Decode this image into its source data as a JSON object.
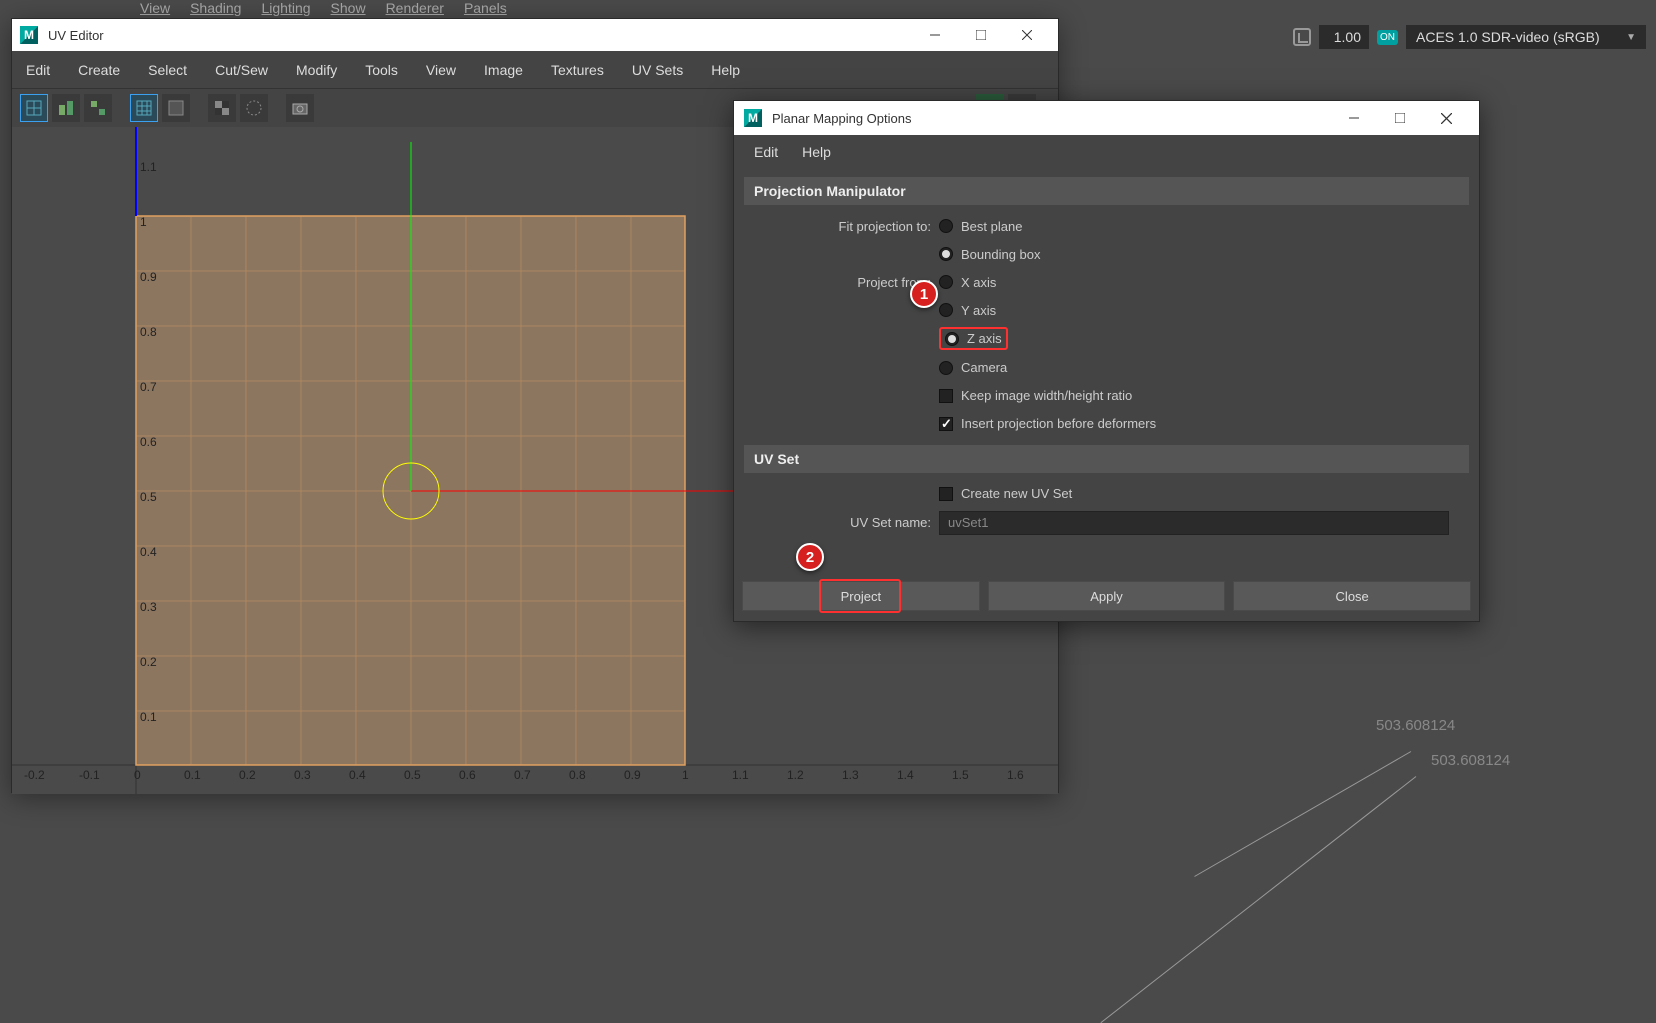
{
  "bg": {
    "menu": [
      "View",
      "Shading",
      "Lighting",
      "Show",
      "Renderer",
      "Panels"
    ],
    "gamma": "1.00",
    "on_badge": "ON",
    "colorspace": "ACES 1.0 SDR-video (sRGB)",
    "measurement1": "503.608124",
    "measurement2": "503.608124"
  },
  "uv_editor": {
    "title": "UV Editor",
    "menus": [
      "Edit",
      "Create",
      "Select",
      "Cut/Sew",
      "Modify",
      "Tools",
      "View",
      "Image",
      "Textures",
      "UV Sets",
      "Help"
    ],
    "axis_labels_y": [
      "1.1",
      "1",
      "0.9",
      "0.8",
      "0.7",
      "0.6",
      "0.5",
      "0.4",
      "0.3",
      "0.2",
      "0.1"
    ],
    "axis_labels_x": [
      "-0.2",
      "-0.1",
      "0",
      "0.1",
      "0.2",
      "0.3",
      "0.4",
      "0.5",
      "0.6",
      "0.7",
      "0.8",
      "0.9",
      "1",
      "1.1",
      "1.2",
      "1.3",
      "1.4",
      "1.5",
      "1.6"
    ]
  },
  "planar": {
    "title": "Planar Mapping Options",
    "menus": [
      "Edit",
      "Help"
    ],
    "section_projection": "Projection Manipulator",
    "fit_label": "Fit projection to:",
    "fit_options": [
      "Best plane",
      "Bounding box"
    ],
    "project_label": "Project from:",
    "project_options": [
      "X axis",
      "Y axis",
      "Z axis",
      "Camera"
    ],
    "keep_ratio": "Keep image width/height ratio",
    "insert_deformers": "Insert projection before deformers",
    "section_uvset": "UV Set",
    "create_uvset": "Create new UV Set",
    "uvset_name_label": "UV Set name:",
    "uvset_name_value": "uvSet1",
    "btn_project": "Project",
    "btn_apply": "Apply",
    "btn_close": "Close"
  },
  "callouts": {
    "c1": "1",
    "c2": "2"
  }
}
